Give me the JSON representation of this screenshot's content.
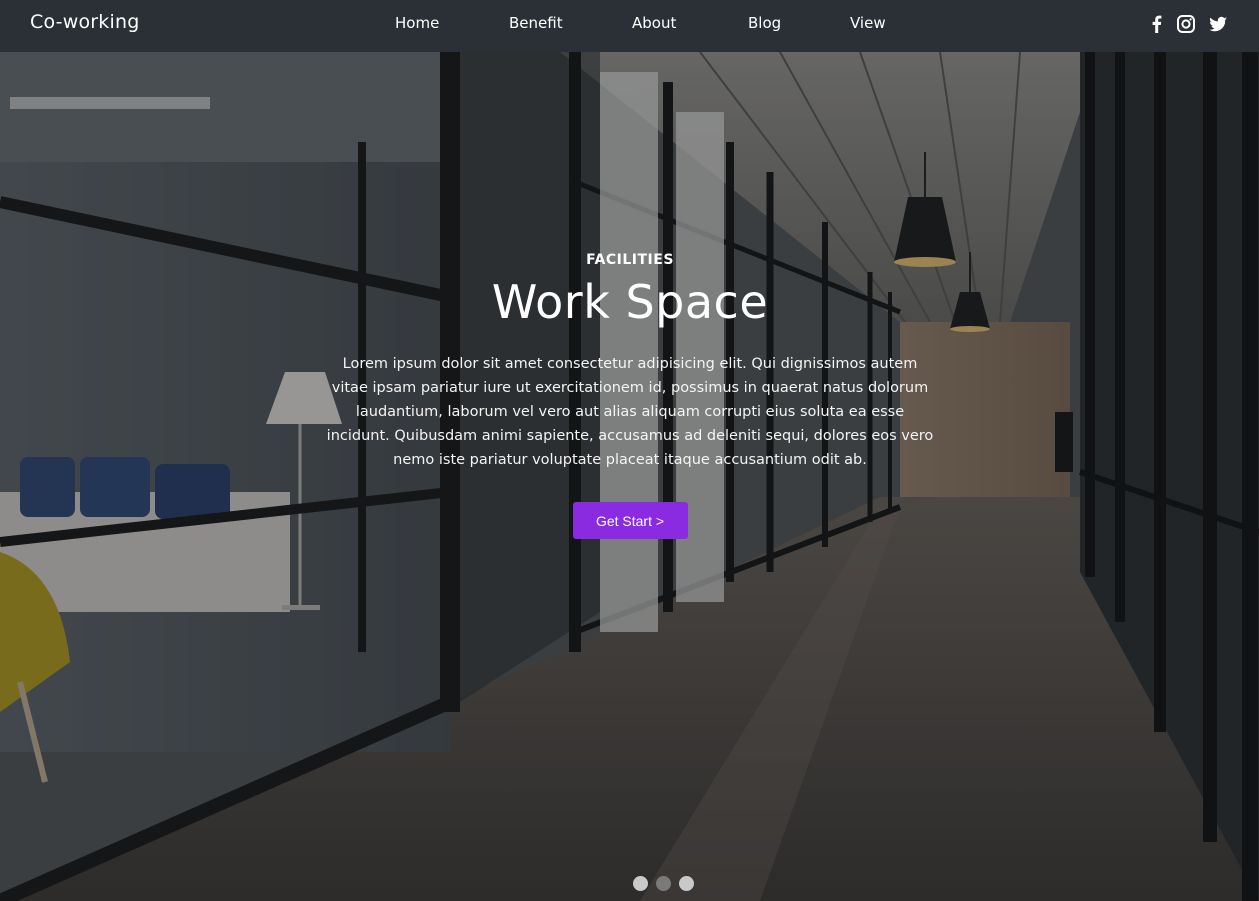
{
  "brand": {
    "name": "Co-working"
  },
  "nav": {
    "items": [
      {
        "label": "Home"
      },
      {
        "label": "Benefit"
      },
      {
        "label": "About"
      },
      {
        "label": "Blog"
      },
      {
        "label": "View"
      }
    ]
  },
  "social": {
    "icons": [
      "facebook-icon",
      "instagram-icon",
      "twitter-icon"
    ]
  },
  "hero": {
    "eyebrow": "FACILITIES",
    "title": "Work Space",
    "lines": [
      "Lorem ipsum dolor sit amet consectetur adipisicing elit. Qui dignissimos autem",
      "vitae ipsam pariatur iure ut exercitationem id, possimus in quaerat natus dolorum",
      "laudantium, laborum vel vero aut alias aliquam corrupti eius soluta ea esse",
      "incidunt. Quibusdam animi sapiente, accusamus ad deleniti sequi, dolores eos vero",
      "nemo iste pariatur voluptate placeat itaque accusantium odit ab."
    ],
    "cta_label": "Get Start >"
  },
  "carousel": {
    "slide_count": 3,
    "active_index": 1
  },
  "colors": {
    "navbar": "#2a3036",
    "accent": "#8a2be2",
    "dot_inactive": "#c9c9c9",
    "dot_active": "#7a7a7a"
  }
}
